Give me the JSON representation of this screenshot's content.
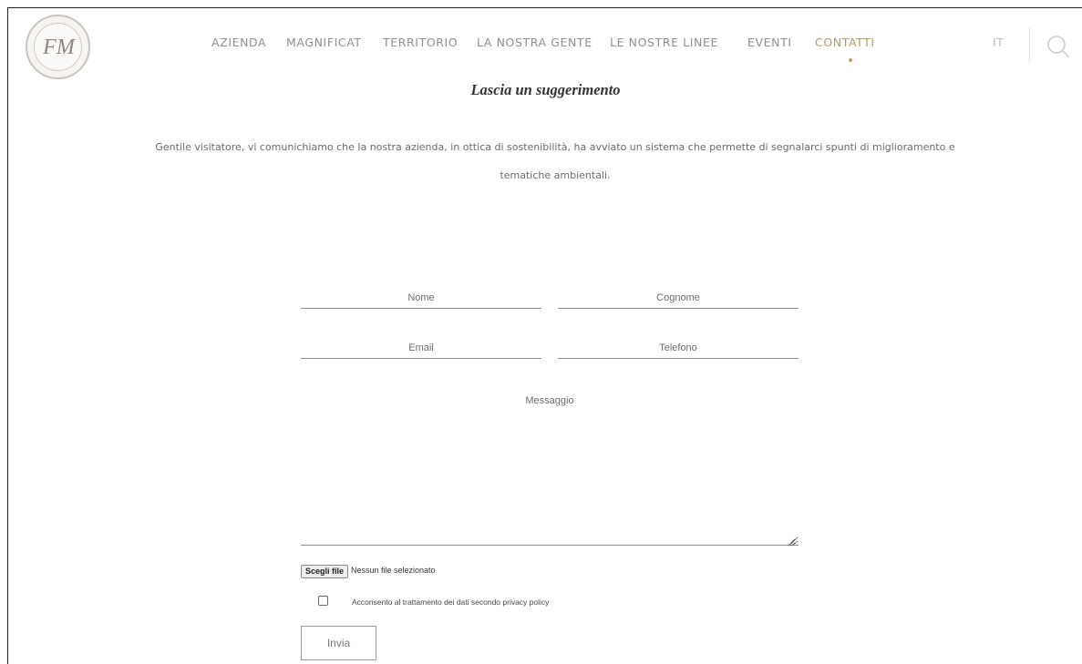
{
  "header": {
    "logo_monogram": "FM",
    "nav": [
      {
        "label": "AZIENDA"
      },
      {
        "label": "MAGNIFICAT"
      },
      {
        "label": "TERRITORIO"
      },
      {
        "label": "LA NOSTRA GENTE"
      },
      {
        "label": "LE NOSTRE LINEE"
      },
      {
        "label": "EVENTI"
      },
      {
        "label": "CONTATTI",
        "active": true
      }
    ],
    "language": "IT",
    "search_icon": "search-icon"
  },
  "colors": {
    "accent": "#b79a62",
    "nav_text": "#8f8f8f",
    "line": "#8a8a8a"
  },
  "main": {
    "title": "Lascia un suggerimento",
    "intro_line1": "Gentile visitatore, vi comunichiamo che la nostra azienda, in ottica di sostenibilità, ha avviato un sistema che permette di segnalarci spunti di miglioramento e",
    "intro_line2": "tematiche ambientali."
  },
  "form": {
    "first_name_placeholder": "Nome",
    "last_name_placeholder": "Cognome",
    "email_placeholder": "Email",
    "phone_placeholder": "Telefono",
    "message_placeholder": "Messaggio",
    "file_button": "Scegli file",
    "file_status": "Nessun file selezionato",
    "consent_label": "Acconsento al trattamento dei dati secondo privacy policy",
    "consent_checked": false,
    "submit_label": "Invia"
  }
}
